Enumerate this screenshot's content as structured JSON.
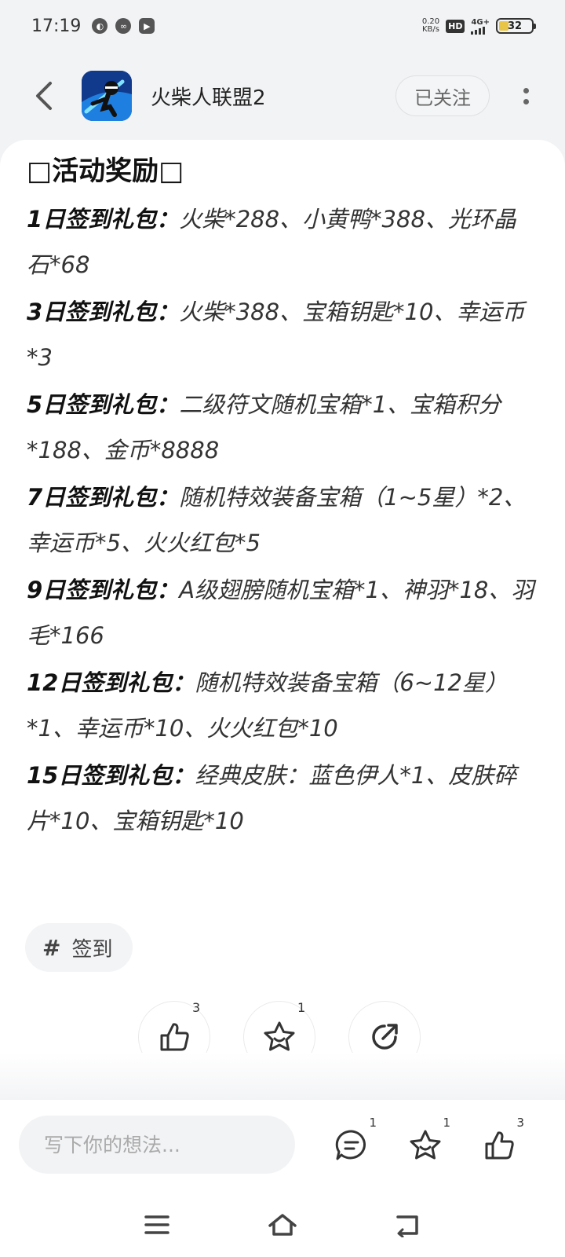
{
  "status_bar": {
    "time": "17:19",
    "net_speed_value": "0.20",
    "net_speed_unit": "KB/s",
    "hd": "HD",
    "network": "4G+",
    "battery": "32"
  },
  "header": {
    "app_name": "火柴人联盟2",
    "follow_label": "已关注"
  },
  "post": {
    "title": "□活动奖励□",
    "rewards": [
      {
        "label": "1日签到礼包：",
        "items": "火柴*288、小黄鸭*388、光环晶石*68"
      },
      {
        "label": "3日签到礼包：",
        "items": "火柴*388、宝箱钥匙*10、幸运币*3"
      },
      {
        "label": "5日签到礼包：",
        "items": "二级符文随机宝箱*1、宝箱积分*188、金币*8888"
      },
      {
        "label": "7日签到礼包：",
        "items": "随机特效装备宝箱（1~5星）*2、幸运币*5、火火红包*5"
      },
      {
        "label": "9日签到礼包：",
        "items": "A级翅膀随机宝箱*1、神羽*18、羽毛*166"
      },
      {
        "label": "12日签到礼包：",
        "items": "随机特效装备宝箱（6~12星）*1、幸运币*10、火火红包*10"
      },
      {
        "label": "15日签到礼包：",
        "items": "经典皮肤：蓝色伊人*1、皮肤碎片*10、宝箱钥匙*10"
      }
    ],
    "tag": {
      "hash": "#",
      "text": "签到"
    }
  },
  "actions": {
    "like_count": "3",
    "collect_count": "1"
  },
  "bottom_bar": {
    "comment_placeholder": "写下你的想法...",
    "comment_count": "1",
    "collect_count": "1",
    "like_count": "3"
  },
  "colors": {
    "background": "#f2f3f5",
    "card": "#ffffff",
    "text_primary": "#111111",
    "text_secondary": "#333333"
  }
}
